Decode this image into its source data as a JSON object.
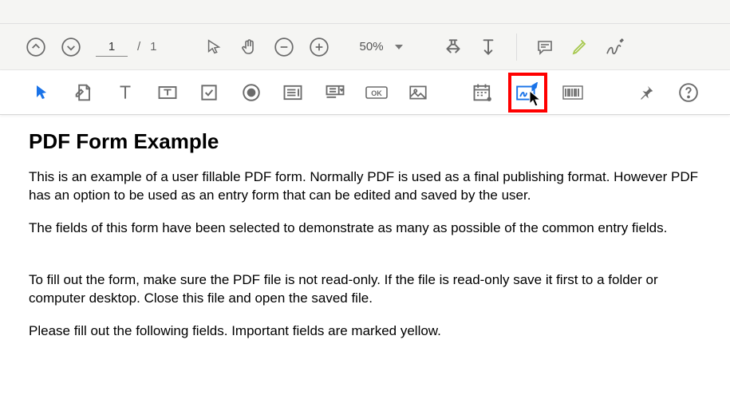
{
  "toolbar": {
    "page_current": "1",
    "page_sep": "/",
    "page_total": "1",
    "zoom": "50%"
  },
  "document": {
    "title": "PDF Form Example",
    "p1": "This is an example of a user fillable PDF form. Normally PDF is used as a final publishing format. However PDF has an option to be used as an entry form that can be edited and saved by the user.",
    "p2": "The fields of this form have been selected to demonstrate as many as possible of the common entry fields.",
    "p3": "To fill out the form, make sure the PDF file is not read-only. If the file is read-only save it first to a folder or computer desktop. Close this file and open the saved file.",
    "p4": "Please fill out the following fields. Important fields are marked yellow."
  }
}
